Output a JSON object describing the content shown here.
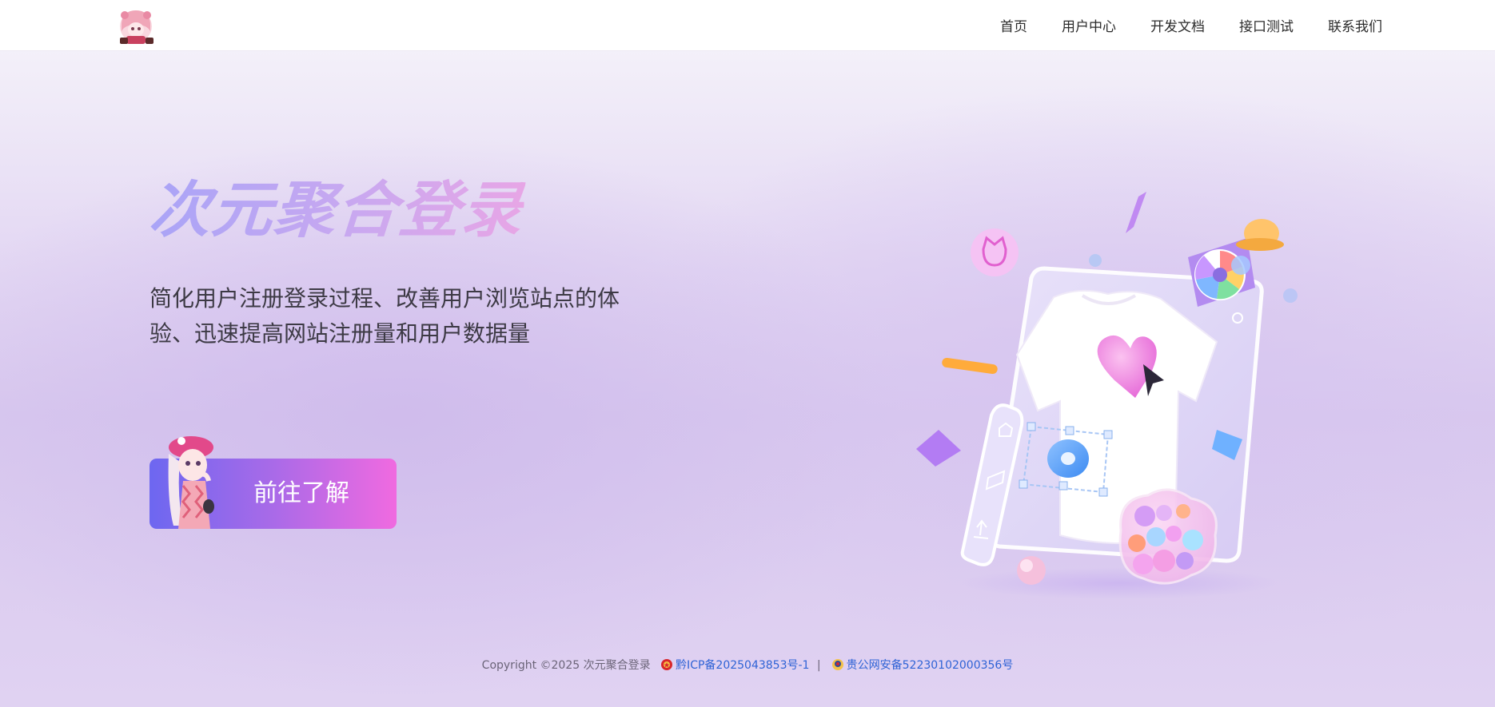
{
  "header": {
    "logo_icon": "anime-girl-logo",
    "nav": [
      {
        "label": "首页"
      },
      {
        "label": "用户中心"
      },
      {
        "label": "开发文档"
      },
      {
        "label": "接口测试"
      },
      {
        "label": "联系我们"
      }
    ]
  },
  "hero": {
    "title": "次元聚合登录",
    "description": "简化用户注册登录过程、改善用户浏览站点的体验、迅速提高网站注册量和用户数据量",
    "cta_label": "前往了解",
    "cta_mascot_icon": "anime-girl-mascot",
    "illustration_icon": "tshirt-design-illustration"
  },
  "footer": {
    "copyright": "Copyright ©2025 次元聚合登录",
    "icp_label": "黔ICP备2025043853号-1",
    "separator": "|",
    "police_label": "贵公网安备52230102000356号",
    "icp_icon": "national-emblem-icon",
    "police_icon": "police-badge-icon"
  },
  "colors": {
    "title_gradient": [
      "#a9a4f7",
      "#e7a6e6"
    ],
    "cta_gradient": [
      "#6d67f0",
      "#f06ae0"
    ],
    "link": "#2f63d6"
  }
}
